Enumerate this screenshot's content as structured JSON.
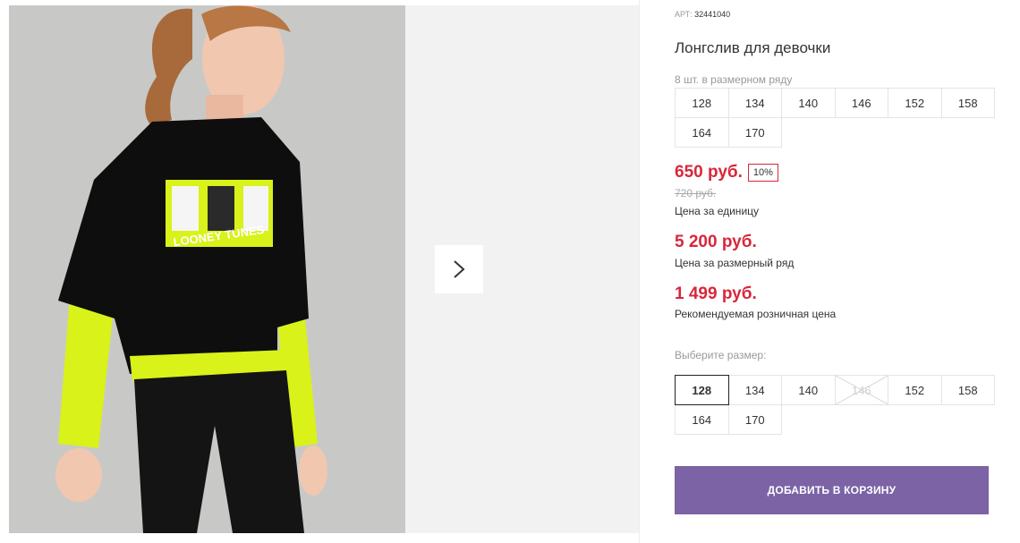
{
  "product": {
    "art_label": "АРТ:",
    "art_value": "32441040",
    "title": "Лонгслив для девочки",
    "pack_label": "8 шт. в размерном ряду",
    "pack_sizes": [
      "128",
      "134",
      "140",
      "146",
      "152",
      "158",
      "164",
      "170"
    ]
  },
  "prices": {
    "unit_price": "650 руб.",
    "discount_badge": "10%",
    "old_price": "720 руб.",
    "unit_label": "Цена за единицу",
    "row_price": "5 200 руб.",
    "row_label": "Цена за размерный ряд",
    "retail_price": "1 499 руб.",
    "retail_label": "Рекомендуемая розничная цена",
    "accent_color": "#d8273a"
  },
  "size_picker": {
    "label": "Выберите размер:",
    "selected": "128",
    "unavailable": [
      "146"
    ],
    "sizes": [
      "128",
      "134",
      "140",
      "146",
      "152",
      "158",
      "164",
      "170"
    ]
  },
  "actions": {
    "add_to_cart": "ДОБАВИТЬ В КОРЗИНУ",
    "button_color": "#7b63a6",
    "next_icon": "chevron-right-icon"
  },
  "image": {
    "print_text": "LOONEY TUNES"
  }
}
